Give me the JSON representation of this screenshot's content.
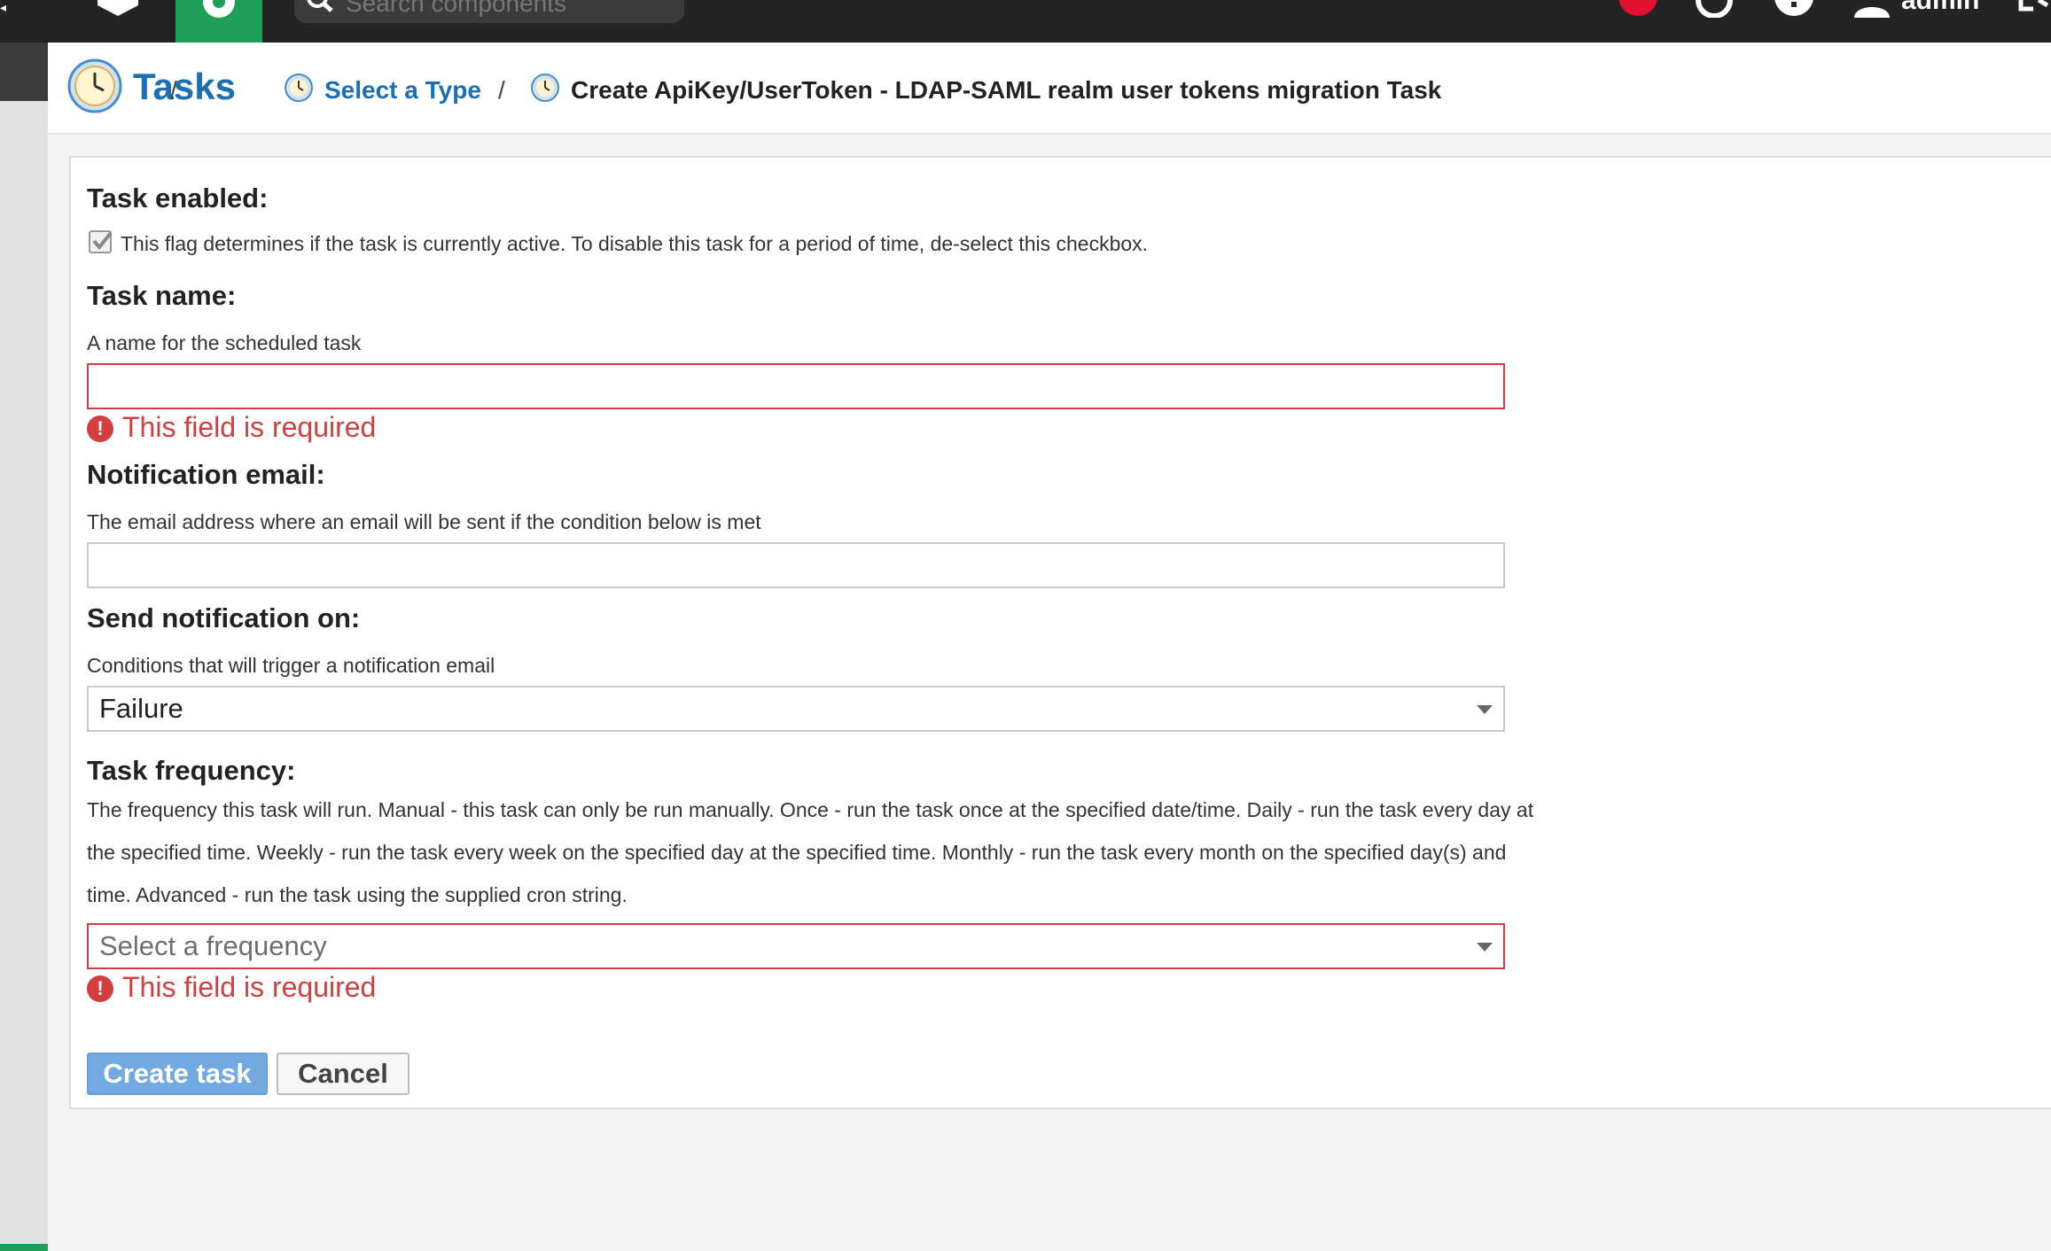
{
  "topbar": {
    "search_placeholder": "Search components",
    "user_label": "admin"
  },
  "breadcrumb": {
    "root": "Tasks",
    "separator": "/",
    "select_type": "Select a Type",
    "current": "Create ApiKey/UserToken - LDAP-SAML realm user tokens migration Task"
  },
  "form": {
    "task_enabled": {
      "heading": "Task enabled:",
      "checked": true,
      "help": "This flag determines if the task is currently active. To disable this task for a period of time, de-select this checkbox."
    },
    "task_name": {
      "heading": "Task name:",
      "help": "A name for the scheduled task",
      "value": "",
      "error": "This field is required"
    },
    "notification_email": {
      "heading": "Notification email:",
      "help": "The email address where an email will be sent if the condition below is met",
      "value": ""
    },
    "send_notification_on": {
      "heading": "Send notification on:",
      "help": "Conditions that will trigger a notification email",
      "selected": "Failure"
    },
    "task_frequency": {
      "heading": "Task frequency:",
      "help": "The frequency this task will run. Manual - this task can only be run manually. Once - run the task once at the specified date/time. Daily - run the task every day at the specified time. Weekly - run the task every week on the specified day at the specified time. Monthly - run the task every month on the specified day(s) and time. Advanced - run the task using the supplied cron string.",
      "placeholder": "Select a frequency",
      "error": "This field is required"
    }
  },
  "buttons": {
    "create": "Create task",
    "cancel": "Cancel"
  },
  "colors": {
    "accent": "#1b6fb3",
    "error": "#d33f3f",
    "active_tab": "#1fa05a",
    "topbar": "#242424",
    "primary_button": "#72a9e0"
  },
  "icons": {
    "root": "clock-icon",
    "crumb": "clock-icon",
    "error": "exclamation-circle-icon"
  }
}
